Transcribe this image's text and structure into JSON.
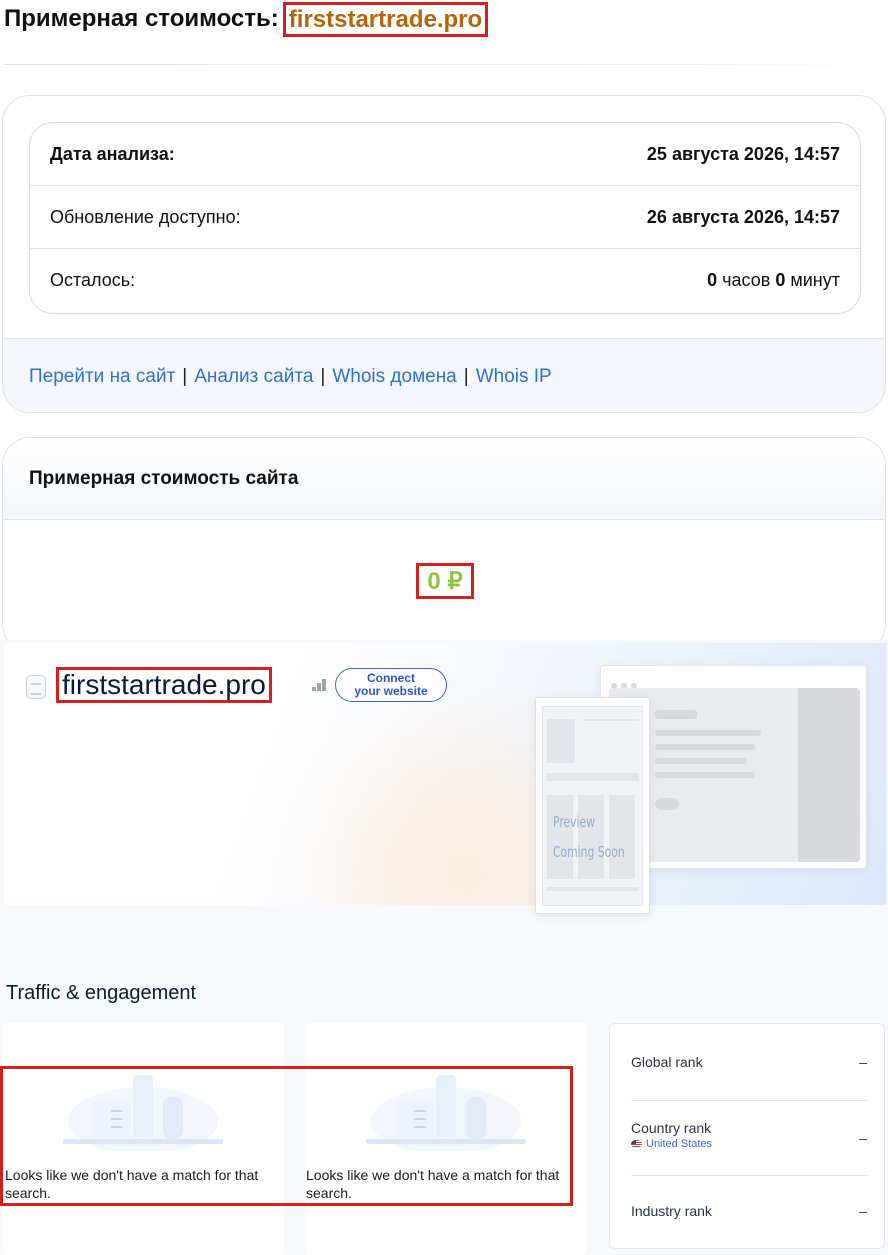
{
  "header": {
    "title_prefix": "Примерная стоимость:",
    "domain": "firststartrade.pro"
  },
  "analysis": {
    "rows": [
      {
        "label": "Дата анализа:",
        "value": "25 августа 2026, 14:57"
      },
      {
        "label": "Обновление доступно:",
        "value": "26 августа 2026, 14:57"
      }
    ],
    "remaining": {
      "label": "Осталось:",
      "hours_value": "0",
      "hours_unit": "часов",
      "minutes_value": "0",
      "minutes_unit": "минут"
    },
    "links": [
      "Перейти на сайт",
      "Анализ сайта",
      "Whois домена",
      "Whois IP"
    ],
    "link_separator": "|"
  },
  "valuation": {
    "heading": "Примерная стоимость сайта",
    "price": "0 ₽"
  },
  "similarweb": {
    "domain": "firststartrade.pro",
    "connect_button": [
      "Connect",
      "your website"
    ],
    "preview_text": [
      "Preview",
      "Coming Soon"
    ],
    "traffic_title": "Traffic & engagement",
    "empty_message": "Looks like we don't have a match for that search.",
    "ranks": [
      {
        "label": "Global rank",
        "value": "–"
      },
      {
        "label": "Country rank",
        "value": "–",
        "sub": "United States"
      },
      {
        "label": "Industry rank",
        "value": "–"
      }
    ]
  },
  "colors": {
    "link": "#2f6fd6",
    "domain_accent": "#b5650a",
    "price": "#8dc63f",
    "highlight_border": "#d51e1e"
  },
  "icons": [
    "document-icon",
    "rank-bars-icon",
    "us-flag-icon",
    "empty-state-illustration"
  ]
}
